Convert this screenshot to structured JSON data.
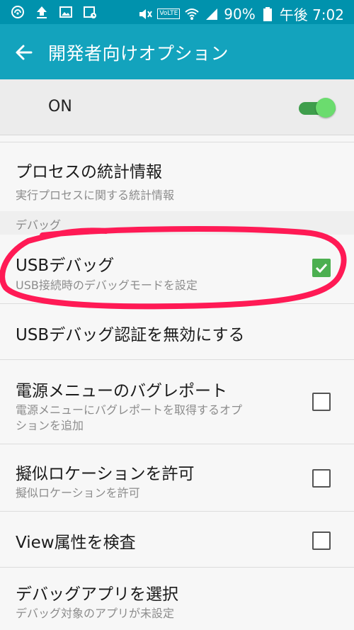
{
  "status_bar": {
    "battery": "90%",
    "time": "午後 7:02",
    "volte": "VoLTE"
  },
  "app_bar": {
    "title": "開発者向けオプション"
  },
  "master_switch": {
    "label": "ON",
    "state": "on"
  },
  "list": {
    "process_stats": {
      "title": "プロセスの統計情報",
      "subtitle": "実行プロセスに関する統計情報"
    },
    "debug_section": "デバッグ",
    "usb_debug": {
      "title": "USBデバッグ",
      "subtitle": "USB接続時のデバッグモードを設定",
      "checked": true
    },
    "revoke_usb_auth": {
      "title": "USBデバッグ認証を無効にする"
    },
    "bug_report": {
      "title": "電源メニューのバグレポート",
      "subtitle_line1": "電源メニューにバグレポートを取得するオプ",
      "subtitle_line2": "ションを追加",
      "checked": false
    },
    "mock_location": {
      "title": "擬似ロケーションを許可",
      "subtitle": "擬似ロケーションを許可",
      "checked": false
    },
    "view_attr": {
      "title": "View属性を検査",
      "checked": false
    },
    "debug_app": {
      "title": "デバッグアプリを選択",
      "subtitle": "デバッグ対象のアプリが未設定"
    }
  },
  "colors": {
    "status_bar": "#0092ad",
    "app_bar": "#13a3bd",
    "switch_on": "#6bdc6e",
    "checkbox_checked": "#4caf50",
    "annotation": "#ff1a55"
  },
  "icons": [
    "wifi-calling-icon",
    "upload-icon",
    "image-icon",
    "calendar-icon",
    "mute-icon",
    "wifi-icon",
    "signal-icon",
    "battery-icon",
    "back-arrow-icon",
    "checkmark-icon"
  ]
}
